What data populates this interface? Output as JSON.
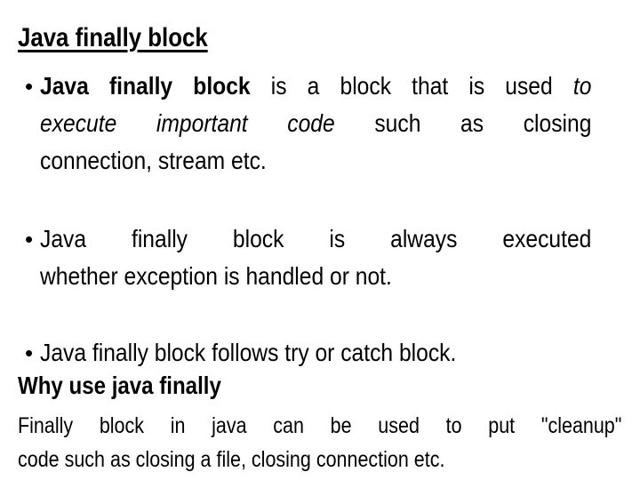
{
  "slide": {
    "title": "Java finally block",
    "bullet_glyph": "•",
    "bullets": [
      {
        "lines": [
          {
            "bold": "Java finally block",
            "normal": " is a block that is used ",
            "italic": "to"
          },
          {
            "italic": "execute important code",
            "normal": " such as closing"
          },
          {
            "normal": "connection, stream etc."
          }
        ]
      },
      {
        "lines": [
          {
            "normal": "Java finally block is always executed"
          },
          {
            "normal": "whether exception is handled or not."
          }
        ]
      },
      {
        "lines": [
          {
            "normal": "Java finally block follows try or catch block."
          }
        ]
      }
    ],
    "subheading": "Why use java finally",
    "paragraph": {
      "lines": [
        "Finally block in java can be used to put \"cleanup\"",
        "code such as closing a file, closing connection etc."
      ]
    }
  }
}
